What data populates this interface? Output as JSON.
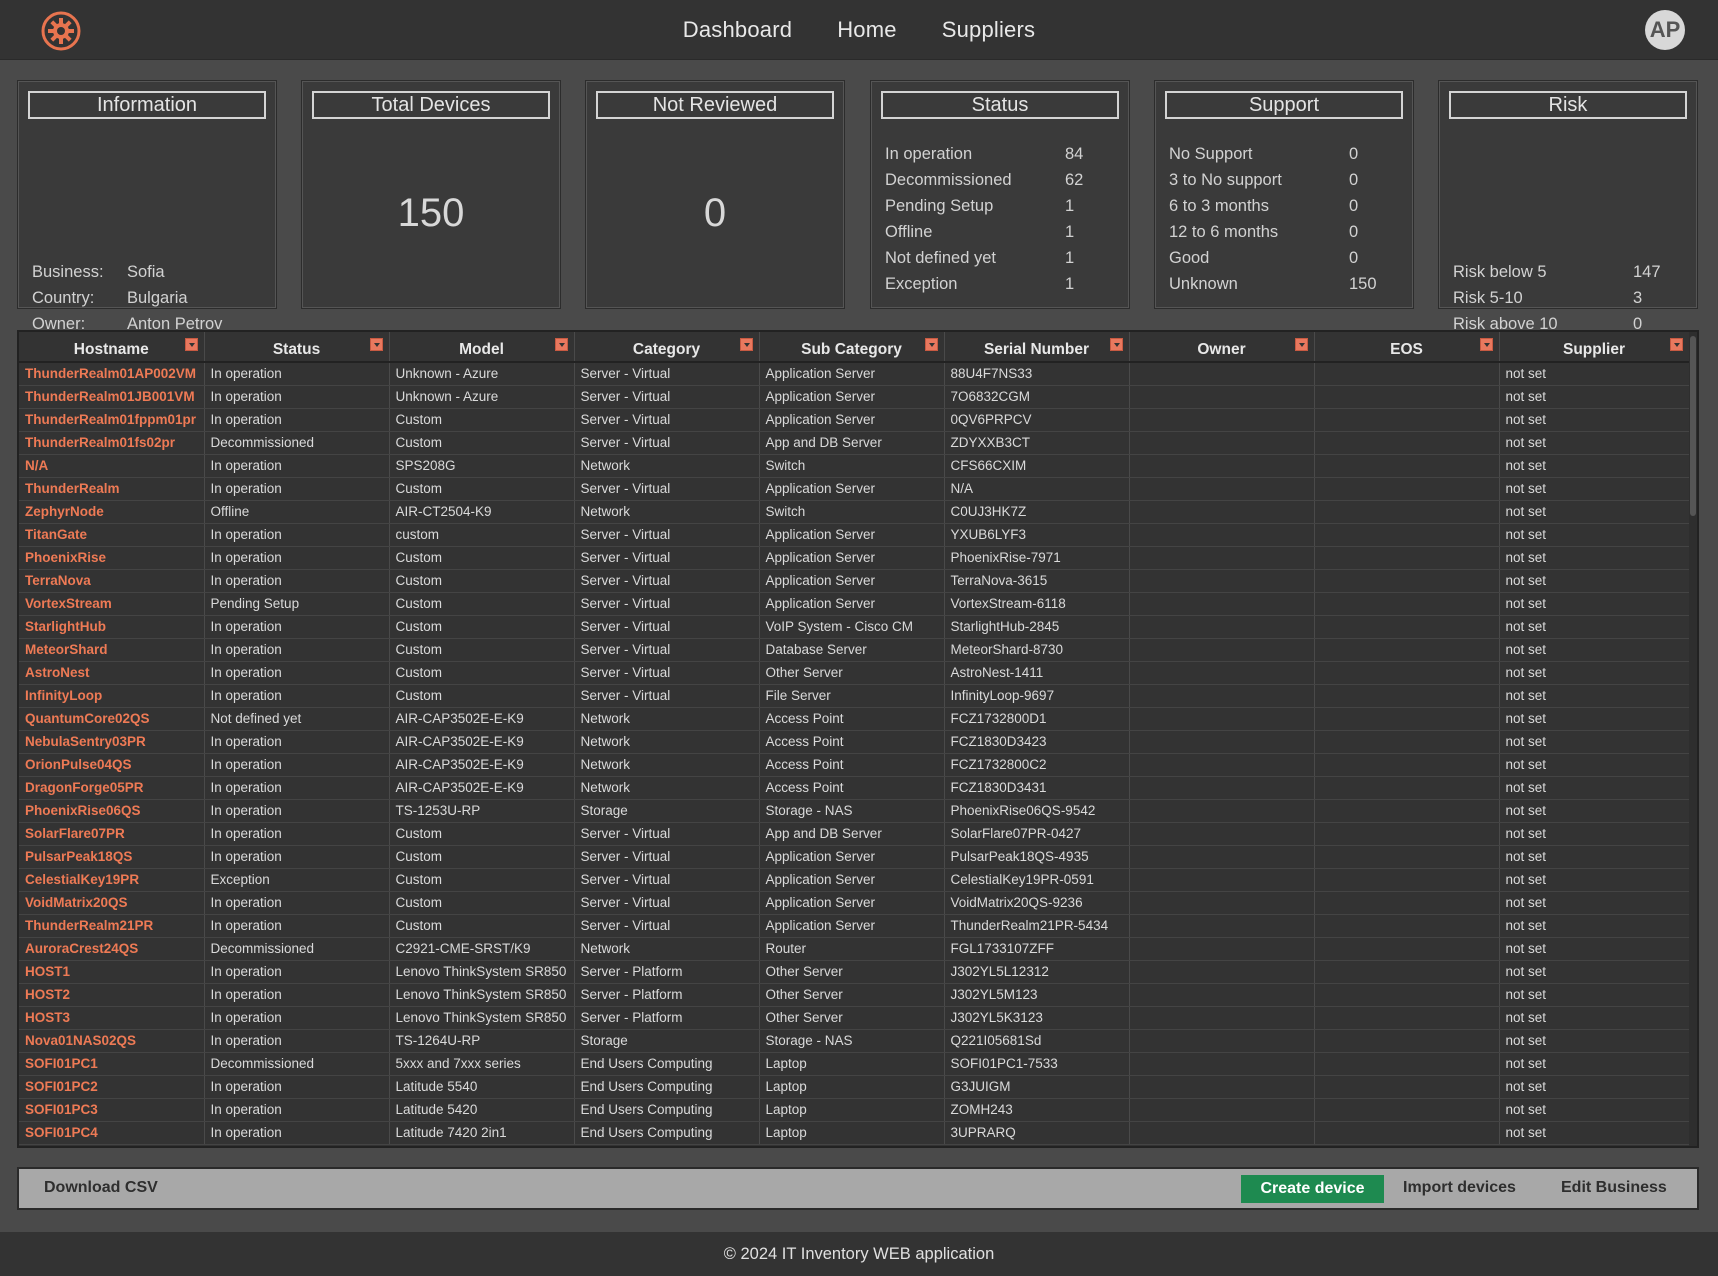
{
  "nav": {
    "items": [
      "Dashboard",
      "Home",
      "Suppliers"
    ],
    "avatar_initials": "AP"
  },
  "cards": {
    "information": {
      "title": "Information",
      "rows": [
        {
          "k": "Business:",
          "v": "Sofia"
        },
        {
          "k": "Country:",
          "v": "Bulgaria"
        },
        {
          "k": "Owner:",
          "v": "Anton Petrov"
        }
      ]
    },
    "total_devices": {
      "title": "Total Devices",
      "value": "150"
    },
    "not_reviewed": {
      "title": "Not Reviewed",
      "value": "0"
    },
    "status": {
      "title": "Status",
      "rows": [
        {
          "k": "In operation",
          "v": "84"
        },
        {
          "k": "Decommissioned",
          "v": "62"
        },
        {
          "k": "Pending Setup",
          "v": "1"
        },
        {
          "k": "Offline",
          "v": "1"
        },
        {
          "k": "Not defined yet",
          "v": "1"
        },
        {
          "k": "Exception",
          "v": "1"
        }
      ]
    },
    "support": {
      "title": "Support",
      "rows": [
        {
          "k": "No Support",
          "v": "0"
        },
        {
          "k": "3 to No support",
          "v": "0"
        },
        {
          "k": "6 to 3 months",
          "v": "0"
        },
        {
          "k": "12 to 6 months",
          "v": "0"
        },
        {
          "k": "Good",
          "v": "0"
        },
        {
          "k": "Unknown",
          "v": "150"
        }
      ]
    },
    "risk": {
      "title": "Risk",
      "rows": [
        {
          "k": "Risk below 5",
          "v": "147"
        },
        {
          "k": "Risk 5-10",
          "v": "3"
        },
        {
          "k": "Risk above 10",
          "v": "0"
        }
      ]
    }
  },
  "table": {
    "columns": [
      "Hostname",
      "Status",
      "Model",
      "Category",
      "Sub Category",
      "Serial Number",
      "Owner",
      "EOS",
      "Supplier"
    ],
    "rows": [
      [
        "ThunderRealm01AP002VM",
        "In operation",
        "Unknown - Azure",
        "Server - Virtual",
        "Application Server",
        "88U4F7NS33",
        "",
        "",
        "not set"
      ],
      [
        "ThunderRealm01JB001VM",
        "In operation",
        "Unknown - Azure",
        "Server - Virtual",
        "Application Server",
        "7O6832CGM",
        "",
        "",
        "not set"
      ],
      [
        "ThunderRealm01fppm01pr",
        "In operation",
        "Custom",
        "Server - Virtual",
        "Application Server",
        "0QV6PRPCV",
        "",
        "",
        "not set"
      ],
      [
        "ThunderRealm01fs02pr",
        "Decommissioned",
        "Custom",
        "Server - Virtual",
        "App and DB Server",
        "ZDYXXB3CT",
        "",
        "",
        "not set"
      ],
      [
        "N/A",
        "In operation",
        "SPS208G",
        "Network",
        "Switch",
        "CFS66CXIM",
        "",
        "",
        "not set"
      ],
      [
        "ThunderRealm",
        "In operation",
        "Custom",
        "Server - Virtual",
        "Application Server",
        "N/A",
        "",
        "",
        "not set"
      ],
      [
        "ZephyrNode",
        "Offline",
        "AIR-CT2504-K9",
        "Network",
        "Switch",
        "C0UJ3HK7Z",
        "",
        "",
        "not set"
      ],
      [
        "TitanGate",
        "In operation",
        "custom",
        "Server - Virtual",
        "Application Server",
        "YXUB6LYF3",
        "",
        "",
        "not set"
      ],
      [
        "PhoenixRise",
        "In operation",
        "Custom",
        "Server - Virtual",
        "Application Server",
        "PhoenixRise-7971",
        "",
        "",
        "not set"
      ],
      [
        "TerraNova",
        "In operation",
        "Custom",
        "Server - Virtual",
        "Application Server",
        "TerraNova-3615",
        "",
        "",
        "not set"
      ],
      [
        "VortexStream",
        "Pending Setup",
        "Custom",
        "Server - Virtual",
        "Application Server",
        "VortexStream-6118",
        "",
        "",
        "not set"
      ],
      [
        "StarlightHub",
        "In operation",
        "Custom",
        "Server - Virtual",
        "VoIP System - Cisco CM",
        "StarlightHub-2845",
        "",
        "",
        "not set"
      ],
      [
        "MeteorShard",
        "In operation",
        "Custom",
        "Server - Virtual",
        "Database Server",
        "MeteorShard-8730",
        "",
        "",
        "not set"
      ],
      [
        "AstroNest",
        "In operation",
        "Custom",
        "Server - Virtual",
        "Other Server",
        "AstroNest-1411",
        "",
        "",
        "not set"
      ],
      [
        "InfinityLoop",
        "In operation",
        "Custom",
        "Server - Virtual",
        "File Server",
        "InfinityLoop-9697",
        "",
        "",
        "not set"
      ],
      [
        "QuantumCore02QS",
        "Not defined yet",
        "AIR-CAP3502E-E-K9",
        "Network",
        "Access Point",
        "FCZ1732800D1",
        "",
        "",
        "not set"
      ],
      [
        "NebulaSentry03PR",
        "In operation",
        "AIR-CAP3502E-E-K9",
        "Network",
        "Access Point",
        "FCZ1830D3423",
        "",
        "",
        "not set"
      ],
      [
        "OrionPulse04QS",
        "In operation",
        "AIR-CAP3502E-E-K9",
        "Network",
        "Access Point",
        "FCZ1732800C2",
        "",
        "",
        "not set"
      ],
      [
        "DragonForge05PR",
        "In operation",
        "AIR-CAP3502E-E-K9",
        "Network",
        "Access Point",
        "FCZ1830D3431",
        "",
        "",
        "not set"
      ],
      [
        "PhoenixRise06QS",
        "In operation",
        "TS-1253U-RP",
        "Storage",
        "Storage - NAS",
        "PhoenixRise06QS-9542",
        "",
        "",
        "not set"
      ],
      [
        "SolarFlare07PR",
        "In operation",
        "Custom",
        "Server - Virtual",
        "App and DB Server",
        "SolarFlare07PR-0427",
        "",
        "",
        "not set"
      ],
      [
        "PulsarPeak18QS",
        "In operation",
        "Custom",
        "Server - Virtual",
        "Application Server",
        "PulsarPeak18QS-4935",
        "",
        "",
        "not set"
      ],
      [
        "CelestialKey19PR",
        "Exception",
        "Custom",
        "Server - Virtual",
        "Application Server",
        "CelestialKey19PR-0591",
        "",
        "",
        "not set"
      ],
      [
        "VoidMatrix20QS",
        "In operation",
        "Custom",
        "Server - Virtual",
        "Application Server",
        "VoidMatrix20QS-9236",
        "",
        "",
        "not set"
      ],
      [
        "ThunderRealm21PR",
        "In operation",
        "Custom",
        "Server - Virtual",
        "Application Server",
        "ThunderRealm21PR-5434",
        "",
        "",
        "not set"
      ],
      [
        "AuroraCrest24QS",
        "Decommissioned",
        "C2921-CME-SRST/K9",
        "Network",
        "Router",
        "FGL1733107ZFF",
        "",
        "",
        "not set"
      ],
      [
        "HOST1",
        "In operation",
        "Lenovo ThinkSystem SR850",
        "Server - Platform",
        "Other Server",
        "J302YL5L12312",
        "",
        "",
        "not set"
      ],
      [
        "HOST2",
        "In operation",
        "Lenovo ThinkSystem SR850",
        "Server - Platform",
        "Other Server",
        "J302YL5M123",
        "",
        "",
        "not set"
      ],
      [
        "HOST3",
        "In operation",
        "Lenovo ThinkSystem SR850",
        "Server - Platform",
        "Other Server",
        "J302YL5K3123",
        "",
        "",
        "not set"
      ],
      [
        "Nova01NAS02QS",
        "In operation",
        "TS-1264U-RP",
        "Storage",
        "Storage - NAS",
        "Q221I05681Sd",
        "",
        "",
        "not set"
      ],
      [
        "SOFI01PC1",
        "Decommissioned",
        "5xxx and 7xxx series",
        "End Users Computing",
        "Laptop",
        "SOFI01PC1-7533",
        "",
        "",
        "not set"
      ],
      [
        "SOFI01PC2",
        "In operation",
        "Latitude 5540",
        "End Users Computing",
        "Laptop",
        "G3JUIGM",
        "",
        "",
        "not set"
      ],
      [
        "SOFI01PC3",
        "In operation",
        "Latitude 5420",
        "End Users Computing",
        "Laptop",
        "ZOMH243",
        "",
        "",
        "not set"
      ],
      [
        "SOFI01PC4",
        "In operation",
        "Latitude 7420 2in1",
        "End Users Computing",
        "Laptop",
        "3UPRARQ",
        "",
        "",
        "not set"
      ]
    ]
  },
  "actions": {
    "download_csv": "Download CSV",
    "create_device": "Create device",
    "import_devices": "Import devices",
    "edit_business": "Edit Business"
  },
  "footer": {
    "text": "© 2024 IT Inventory WEB application"
  },
  "colors": {
    "accent": "#ee7a55",
    "create": "#1e8a50"
  }
}
